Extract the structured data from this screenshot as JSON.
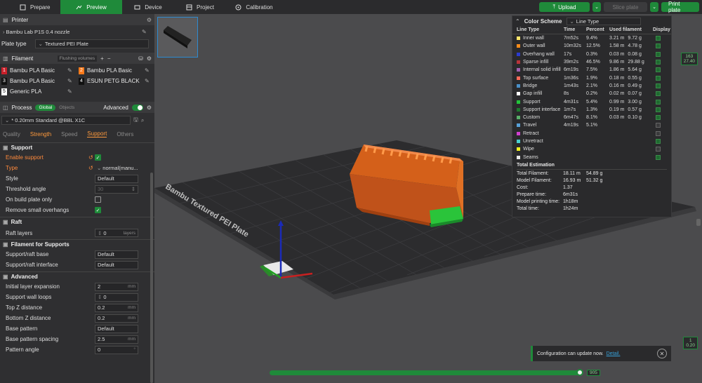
{
  "topbar": {
    "tabs": [
      {
        "label": "Prepare",
        "icon": "prepare-icon",
        "active": false
      },
      {
        "label": "Preview",
        "icon": "preview-icon",
        "active": true
      },
      {
        "label": "Device",
        "icon": "device-icon",
        "active": false
      },
      {
        "label": "Project",
        "icon": "project-icon",
        "active": false
      },
      {
        "label": "Calibration",
        "icon": "calibration-icon",
        "active": false
      }
    ],
    "upload": "Upload",
    "slice_plate": "Slice plate",
    "print_plate": "Print plate"
  },
  "printer": {
    "header": "Printer",
    "name": "Bambu Lab P1S 0.4 nozzle",
    "plate_type_label": "Plate type",
    "plate_type": "Textured PEI Plate"
  },
  "filament": {
    "header": "Filament",
    "flushing": "Flushing volumes",
    "items": [
      {
        "num": "1",
        "name": "Bambu PLA Basic",
        "color": "#c8202a"
      },
      {
        "num": "2",
        "name": "Bambu PLA Basic",
        "color": "#ff7a1a"
      },
      {
        "num": "3",
        "name": "Bambu PLA Basic",
        "color": "#111111"
      },
      {
        "num": "4",
        "name": "ESUN PETG BLACK",
        "color": "#111111"
      },
      {
        "num": "5",
        "name": "Generic PLA",
        "color": "#ffffff"
      }
    ]
  },
  "process": {
    "header": "Process",
    "global": "Global",
    "objects": "Objects",
    "advanced": "Advanced",
    "preset": "* 0.20mm Standard @BBL X1C",
    "subtabs": [
      "Quality",
      "Strength",
      "Speed",
      "Support",
      "Others"
    ]
  },
  "support": {
    "group": "Support",
    "enable_label": "Enable support",
    "type_label": "Type",
    "type_value": "normal(manu...",
    "style_label": "Style",
    "style_value": "Default",
    "threshold_label": "Threshold angle",
    "threshold_value": "30",
    "on_build_label": "On build plate only",
    "remove_label": "Remove small overhangs"
  },
  "raft": {
    "group": "Raft",
    "layers_label": "Raft layers",
    "layers_value": "0",
    "layers_unit": "layers"
  },
  "fil_support": {
    "group": "Filament for Supports",
    "base_label": "Support/raft base",
    "base_value": "Default",
    "iface_label": "Support/raft interface",
    "iface_value": "Default"
  },
  "advanced": {
    "group": "Advanced",
    "rows": [
      {
        "label": "Initial layer expansion",
        "value": "2",
        "unit": "mm"
      },
      {
        "label": "Support wall loops",
        "value": "0",
        "unit": ""
      },
      {
        "label": "Top Z distance",
        "value": "0.2",
        "unit": "mm"
      },
      {
        "label": "Bottom Z distance",
        "value": "0.2",
        "unit": "mm"
      },
      {
        "label": "Base pattern",
        "value": "Default",
        "unit": ""
      },
      {
        "label": "Base pattern spacing",
        "value": "2.5",
        "unit": "mm"
      },
      {
        "label": "Pattern angle",
        "value": "0",
        "unit": "°"
      }
    ]
  },
  "legend": {
    "color_scheme_label": "Color Scheme",
    "color_scheme_value": "Line Type",
    "columns": [
      "Line Type",
      "Time",
      "Percent",
      "Used filament",
      "Display"
    ],
    "rows": [
      {
        "name": "Inner wall",
        "color": "#ffe66b",
        "time": "7m52s",
        "percent": "9.4%",
        "len": "3.21 m",
        "weight": "9.72 g",
        "on": true
      },
      {
        "name": "Outer wall",
        "color": "#ff8c1a",
        "time": "10m32s",
        "percent": "12.5%",
        "len": "1.58 m",
        "weight": "4.78 g",
        "on": true
      },
      {
        "name": "Overhang wall",
        "color": "#2b3bd0",
        "time": "17s",
        "percent": "0.3%",
        "len": "0.03 m",
        "weight": "0.08 g",
        "on": true
      },
      {
        "name": "Sparse infill",
        "color": "#b8343a",
        "time": "39m2s",
        "percent": "46.5%",
        "len": "9.86 m",
        "weight": "29.88 g",
        "on": true
      },
      {
        "name": "Internal solid infill",
        "color": "#a060b0",
        "time": "6m19s",
        "percent": "7.5%",
        "len": "1.86 m",
        "weight": "5.64 g",
        "on": true
      },
      {
        "name": "Top surface",
        "color": "#ff6a5a",
        "time": "1m36s",
        "percent": "1.9%",
        "len": "0.18 m",
        "weight": "0.55 g",
        "on": true
      },
      {
        "name": "Bridge",
        "color": "#4a90c8",
        "time": "1m43s",
        "percent": "2.1%",
        "len": "0.16 m",
        "weight": "0.49 g",
        "on": true
      },
      {
        "name": "Gap infill",
        "color": "#ffffff",
        "time": "8s",
        "percent": "0.2%",
        "len": "0.02 m",
        "weight": "0.07 g",
        "on": true
      },
      {
        "name": "Support",
        "color": "#22c43a",
        "time": "4m31s",
        "percent": "5.4%",
        "len": "0.99 m",
        "weight": "3.00 g",
        "on": true
      },
      {
        "name": "Support interface",
        "color": "#1e7a2e",
        "time": "1m7s",
        "percent": "1.3%",
        "len": "0.19 m",
        "weight": "0.57 g",
        "on": true
      },
      {
        "name": "Custom",
        "color": "#5ab06a",
        "time": "6m47s",
        "percent": "8.1%",
        "len": "0.03 m",
        "weight": "0.10 g",
        "on": true
      },
      {
        "name": "Travel",
        "color": "#58a0d8",
        "time": "4m19s",
        "percent": "5.1%",
        "len": "",
        "weight": "",
        "on": false
      },
      {
        "name": "Retract",
        "color": "#d040d0",
        "time": "",
        "percent": "",
        "len": "",
        "weight": "",
        "on": false
      },
      {
        "name": "Unretract",
        "color": "#4ad0d0",
        "time": "",
        "percent": "",
        "len": "",
        "weight": "",
        "on": true
      },
      {
        "name": "Wipe",
        "color": "#f0f020",
        "time": "",
        "percent": "",
        "len": "",
        "weight": "",
        "on": false
      },
      {
        "name": "Seams",
        "color": "#e8e8e8",
        "time": "",
        "percent": "",
        "len": "",
        "weight": "",
        "on": true
      }
    ],
    "total": {
      "header": "Total Estimation",
      "rows": [
        {
          "label": "Total Filament:",
          "a": "18.11 m",
          "b": "54.89 g"
        },
        {
          "label": "Model Filament:",
          "a": "16.93 m",
          "b": "51.32 g"
        },
        {
          "label": "Cost:",
          "a": "1.37",
          "b": ""
        },
        {
          "label": "Prepare time:",
          "a": "6m31s",
          "b": ""
        },
        {
          "label": "Model printing time:",
          "a": "1h18m",
          "b": ""
        },
        {
          "label": "Total time:",
          "a": "1h24m",
          "b": ""
        }
      ]
    }
  },
  "notice": {
    "text": "Configuration can update now.",
    "link": "Detail."
  },
  "layer_slider": {
    "top_a": "163",
    "top_b": "27.40",
    "bottom_a": "1",
    "bottom_b": "0.20"
  },
  "move_slider": {
    "value": "905"
  }
}
